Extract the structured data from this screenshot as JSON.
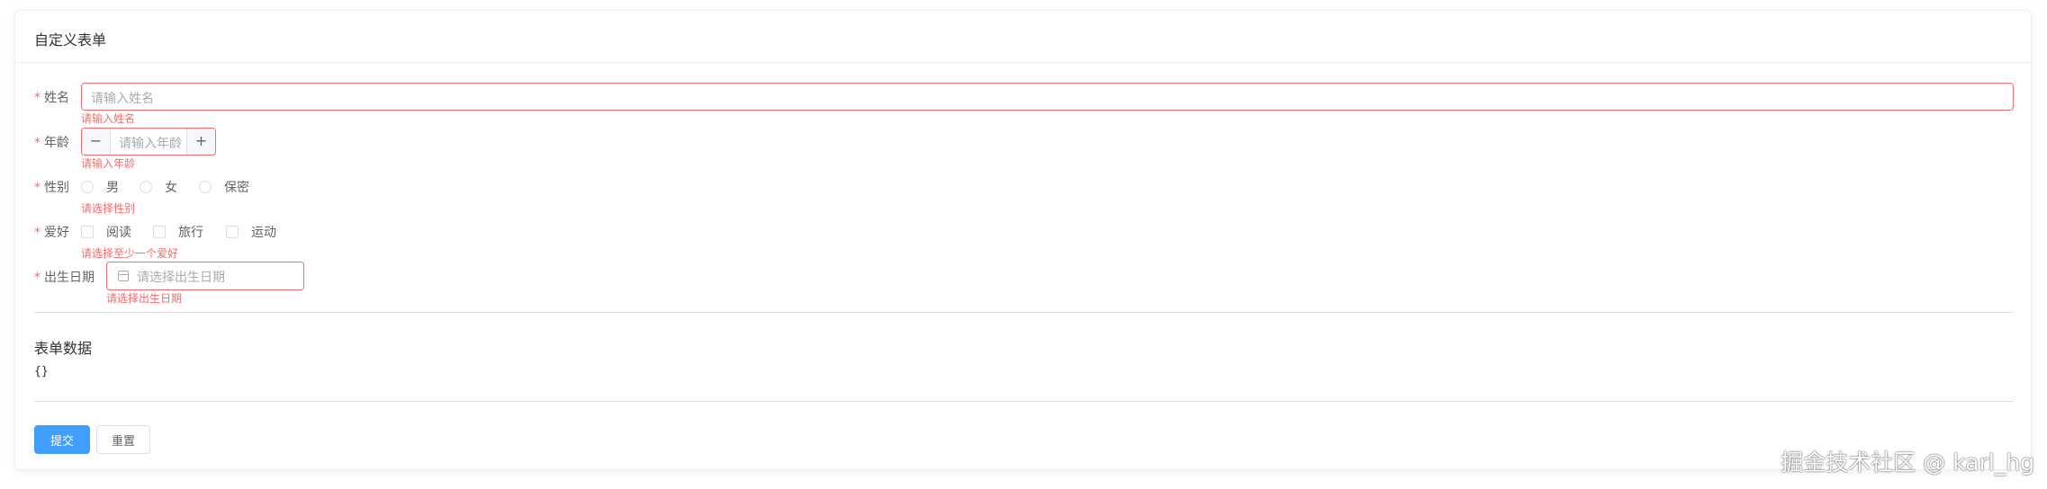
{
  "card": {
    "title": "自定义表单"
  },
  "form": {
    "required_mark": "*",
    "name": {
      "label": "姓名",
      "placeholder": "请输入姓名",
      "error": "请输入姓名"
    },
    "age": {
      "label": "年龄",
      "placeholder": "请输入年龄",
      "error": "请输入年龄",
      "minus_icon": "minus-icon",
      "plus_icon": "plus-icon",
      "minus": "−",
      "plus": "+"
    },
    "gender": {
      "label": "性别",
      "options": [
        "男",
        "女",
        "保密"
      ],
      "error": "请选择性别"
    },
    "hobby": {
      "label": "爱好",
      "options": [
        "阅读",
        "旅行",
        "运动"
      ],
      "error": "请选择至少一个爱好"
    },
    "birthday": {
      "label": "出生日期",
      "placeholder": "请选择出生日期",
      "error": "请选择出生日期",
      "icon": "calendar-icon"
    }
  },
  "data_section": {
    "title": "表单数据",
    "content": "{}"
  },
  "actions": {
    "submit": "提交",
    "reset": "重置"
  },
  "watermark": "掘金技术社区 @ karl_hg",
  "colors": {
    "error": "#f56c6c",
    "primary": "#409eff",
    "border": "#dcdfe6",
    "text": "#606266"
  }
}
